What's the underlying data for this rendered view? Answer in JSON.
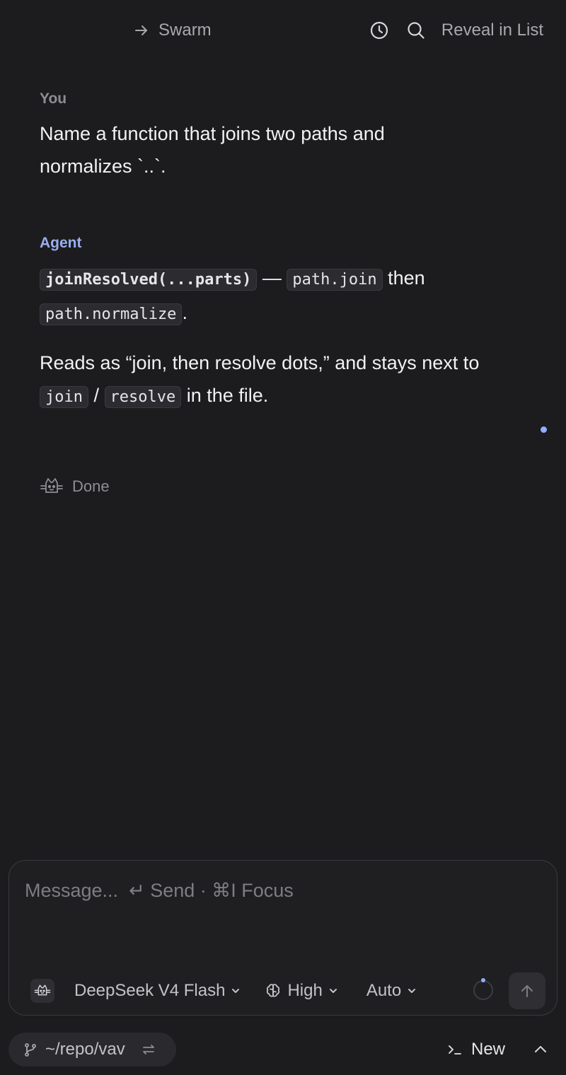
{
  "header": {
    "swarm_label": "Swarm",
    "reveal_label": "Reveal in List",
    "icons": [
      "arrow-right-icon",
      "history-icon",
      "search-icon"
    ]
  },
  "conversation": {
    "user": {
      "role": "You",
      "text": "Name a function that joins two paths and normalizes `..`."
    },
    "agent": {
      "role": "Agent",
      "para1": {
        "code1": "joinResolved(...parts)",
        "dash": " — ",
        "code2": "path.join",
        "text1": " then",
        "code3": "path.normalize",
        "text2": "."
      },
      "para2": {
        "text1": "Reads as “join, then resolve dots,” and stays next to ",
        "code1": "join",
        "sep": " / ",
        "code2": "resolve",
        "text2": " in the file."
      }
    },
    "status": "Done"
  },
  "composer": {
    "placeholder": "Message...  ↵ Send · ⌘I Focus",
    "model": "DeepSeek V4 Flash",
    "effort": "High",
    "mode": "Auto"
  },
  "footer": {
    "repo": "~/repo/vav",
    "new_label": "New"
  },
  "colors": {
    "background": "#1c1c1e",
    "agent_accent": "#9aaef0",
    "indicator": "#8fb0ff"
  }
}
